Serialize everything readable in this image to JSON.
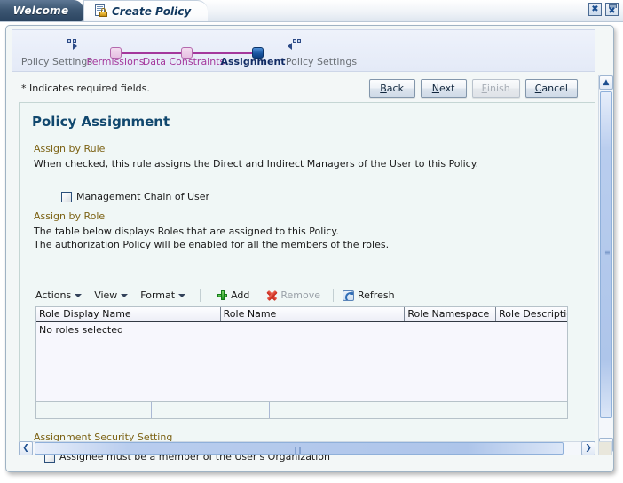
{
  "tabs": [
    {
      "label": "Welcome",
      "active": false,
      "icon": null
    },
    {
      "label": "Create Policy",
      "active": true,
      "icon": "page-lock-icon"
    }
  ],
  "window_controls": {
    "close_label": "✖",
    "detach_label": "✖"
  },
  "train": {
    "prev_arrow_icon": "train-previous-arrow-icon",
    "next_arrow_icon": "train-next-arrow-icon",
    "steps": [
      {
        "label": "Policy Settings",
        "state": "overflow-left"
      },
      {
        "label": "Permissions",
        "state": "visited"
      },
      {
        "label": "Data Constraints",
        "state": "visited"
      },
      {
        "label": "Assignment",
        "state": "current"
      },
      {
        "label": "Policy Settings",
        "state": "overflow-right"
      }
    ]
  },
  "required_note": "* Indicates required fields.",
  "buttons": [
    {
      "id": "back",
      "pre": "",
      "mnemonic": "B",
      "post": "ack",
      "disabled": false
    },
    {
      "id": "next",
      "pre": "",
      "mnemonic": "N",
      "post": "ext",
      "disabled": false
    },
    {
      "id": "finish",
      "pre": "",
      "mnemonic": "F",
      "post": "inish",
      "disabled": true
    },
    {
      "id": "cancel",
      "pre": "",
      "mnemonic": "C",
      "post": "ancel",
      "disabled": false
    }
  ],
  "panel": {
    "title": "Policy Assignment",
    "assign_by_rule": {
      "heading": "Assign by Rule",
      "description": "When checked, this rule assigns the Direct and Indirect Managers of the User to this Policy.",
      "checkbox_label": "Management Chain of User",
      "checked": false
    },
    "assign_by_role": {
      "heading": "Assign by Role",
      "description_line1": "The table below displays Roles that are assigned to this Policy.",
      "description_line2": "The authorization Policy will be enabled for all the members of the roles."
    },
    "security_setting": {
      "heading": "Assignment Security Setting",
      "checkbox_label": "Assignee must be a member of the User's Organization",
      "checked": false
    }
  },
  "table_toolbar": {
    "menus": [
      {
        "label": "Actions",
        "icon": "chevron-down-icon"
      },
      {
        "label": "View",
        "icon": "chevron-down-icon"
      },
      {
        "label": "Format",
        "icon": "chevron-down-icon"
      }
    ],
    "actions": [
      {
        "label": "Add",
        "icon": "plus-icon",
        "disabled": false
      },
      {
        "label": "Remove",
        "icon": "delete-x-icon",
        "disabled": true
      },
      {
        "label": "Refresh",
        "icon": "refresh-icon",
        "disabled": false
      }
    ]
  },
  "roles_table": {
    "columns": [
      "Role Display Name",
      "Role Name",
      "Role Namespace",
      "Role Description"
    ],
    "rows": [],
    "empty_message": "No roles selected"
  },
  "scrollbars": {
    "vertical": {
      "up_glyph": "▲",
      "down_glyph": "▼",
      "grip": "≡"
    },
    "horizontal": {
      "left_glyph": "❮",
      "right_glyph": "❯",
      "grip": "‖‖"
    }
  },
  "colors": {
    "accent_blue": "#11486e",
    "section_heading": "#7c6214",
    "train_link": "#a4389c",
    "panel_bg": "#f0f7f6"
  }
}
